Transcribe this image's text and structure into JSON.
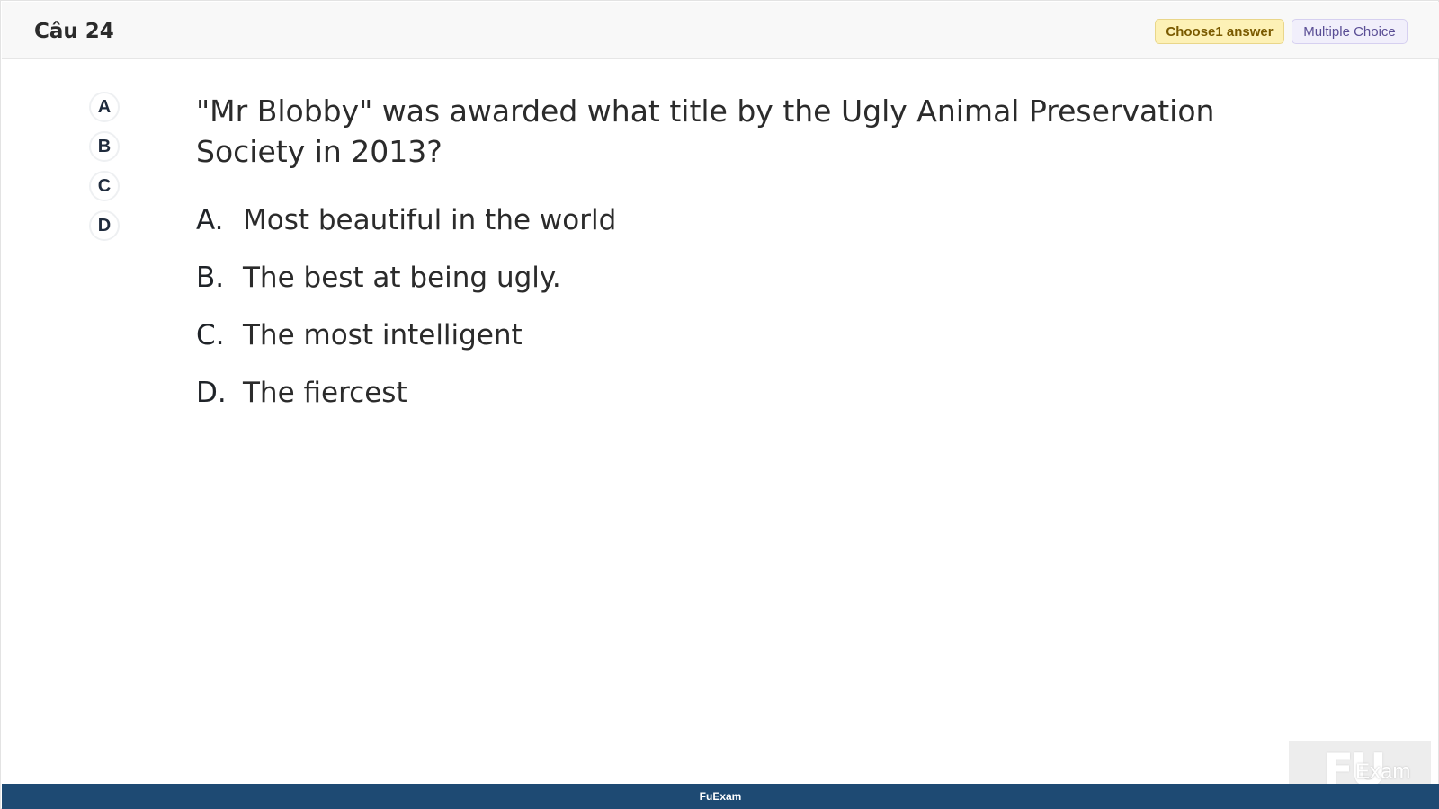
{
  "header": {
    "question_number": "Câu 24",
    "choose_badge": "Choose1 answer",
    "type_badge": "Multiple Choice"
  },
  "side_choices": [
    "A",
    "B",
    "C",
    "D"
  ],
  "question": {
    "text": "\"Mr Blobby\" was awarded what title by the Ugly Animal Preservation Society in 2013?"
  },
  "options": [
    {
      "letter": "A.",
      "text": "Most beautiful in the world"
    },
    {
      "letter": "B.",
      "text": "The best at being ugly."
    },
    {
      "letter": "C.",
      "text": "The most intelligent"
    },
    {
      "letter": "D.",
      "text": "The fiercest"
    }
  ],
  "watermark": {
    "logo": "FU",
    "text": "Exam"
  },
  "footer": {
    "brand": "FuExam"
  }
}
